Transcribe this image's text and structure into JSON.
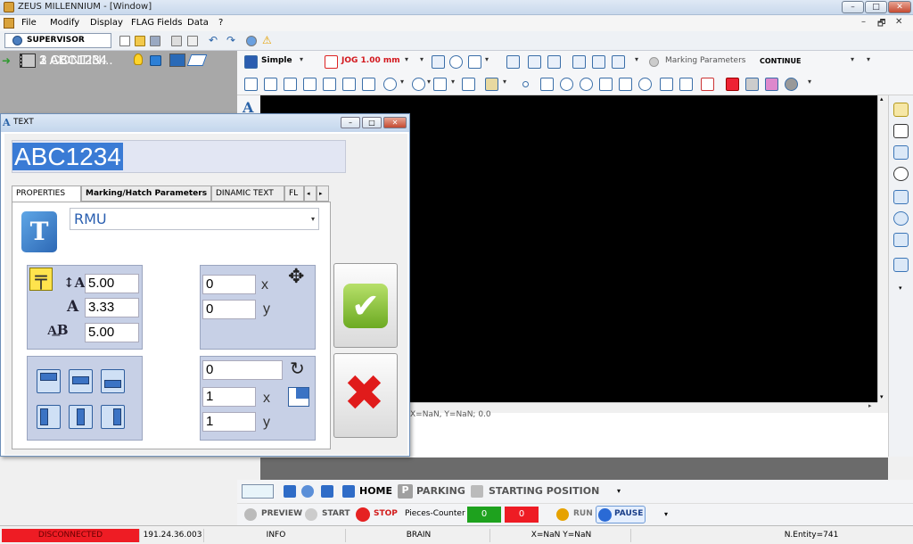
{
  "window": {
    "title": "ZEUS MILLENNIUM - [Window]",
    "min": "–",
    "max": "□",
    "close": "✕"
  },
  "menu": {
    "items": [
      "File",
      "Modify",
      "Display",
      "FLAG Fields",
      "Data",
      "?"
    ],
    "mdi_min": "–",
    "mdi_restore": "🗗",
    "mdi_close": "✕"
  },
  "user": {
    "role": "SUPERVISOR"
  },
  "jobs": [
    {
      "label": "1 ABC1234"
    },
    {
      "label": "2 ABC1234"
    },
    {
      "label": "3 CONTIN..."
    }
  ],
  "toolbar": {
    "mode": "Simple",
    "jog": "JOG 1.00 mm",
    "marking_label": "Marking Parameters",
    "marking_value": "CONTINUE"
  },
  "canvas": {
    "log_text": "X=NaN, Y=NaN; 0.0"
  },
  "bottom": {
    "home": "HOME",
    "parking": "PARKING",
    "starting_position": "STARTING POSITION",
    "preview": "PREVIEW",
    "start": "START",
    "stop": "STOP",
    "pieces_counter_label": "Pieces-Counter",
    "counter_ok": "0",
    "counter_ko": "0",
    "run": "RUN",
    "pause": "PAUSE"
  },
  "status": {
    "connection": "DISCONNECTED",
    "ip": "191.24.36.003",
    "info": "INFO",
    "brain": "BRAIN",
    "coords": "X=NaN Y=NaN",
    "entity": "N.Entity=741"
  },
  "dialog": {
    "title": "TEXT",
    "text_value": "ABC1234",
    "tabs": [
      "PROPERTIES",
      "Marking/Hatch Parameters",
      "DINAMIC TEXT",
      "FL"
    ],
    "font": "RMU",
    "height": "5.00",
    "width": "3.33",
    "spacing": "5.00",
    "pos_x": "0",
    "pos_y": "0",
    "x_label": "x",
    "y_label": "y",
    "rotation": "0",
    "scale_x": "1",
    "scale_y": "1"
  },
  "colors": {
    "connection_bg": "#ee1c24",
    "counter_ok_bg": "#1ea21e",
    "counter_ko_bg": "#ee1c24",
    "canvas_bg": "#000000"
  }
}
